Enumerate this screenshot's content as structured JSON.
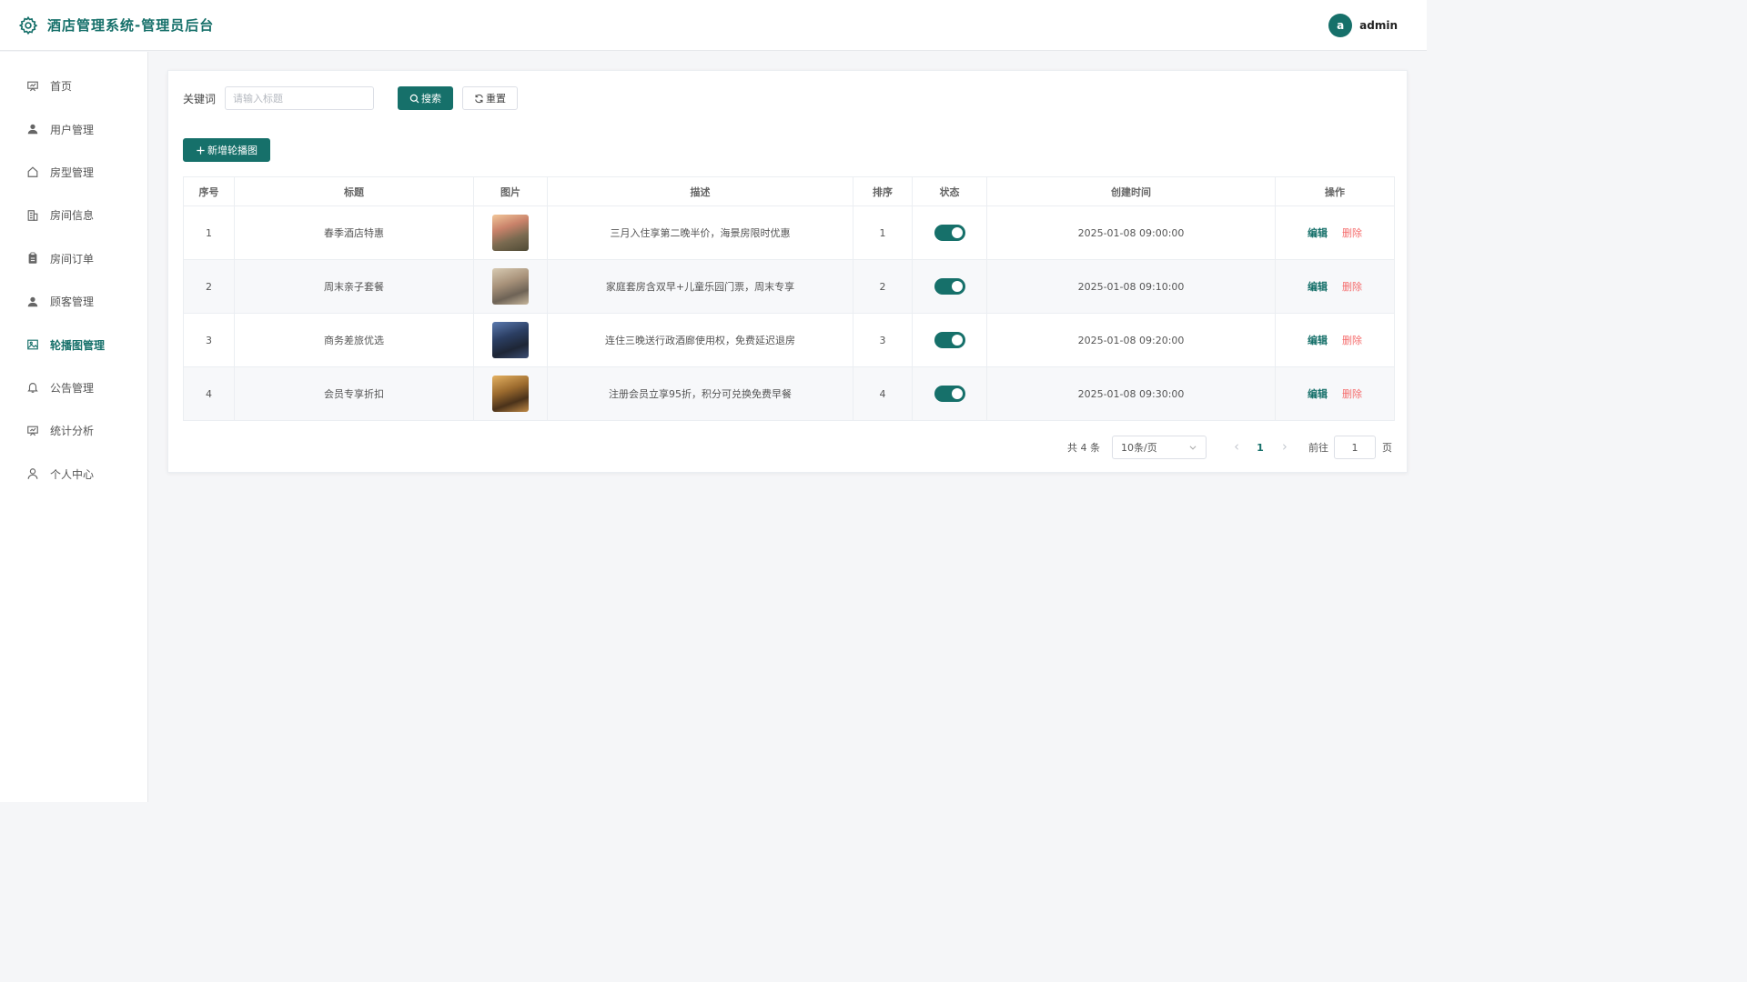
{
  "header": {
    "title": "酒店管理系统-管理员后台",
    "avatar_letter": "a",
    "username": "admin"
  },
  "sidebar": {
    "items": [
      {
        "label": "首页",
        "icon": "presentation-icon"
      },
      {
        "label": "用户管理",
        "icon": "user-icon"
      },
      {
        "label": "房型管理",
        "icon": "house-icon"
      },
      {
        "label": "房间信息",
        "icon": "building-icon"
      },
      {
        "label": "房间订单",
        "icon": "clipboard-icon"
      },
      {
        "label": "顾客管理",
        "icon": "user-icon"
      },
      {
        "label": "轮播图管理",
        "icon": "picture-icon",
        "active": true
      },
      {
        "label": "公告管理",
        "icon": "bell-icon"
      },
      {
        "label": "统计分析",
        "icon": "presentation-icon"
      },
      {
        "label": "个人中心",
        "icon": "user-outline-icon"
      }
    ]
  },
  "search": {
    "label": "关键词",
    "placeholder": "请输入标题",
    "search_label": "搜索",
    "reset_label": "重置"
  },
  "toolbar": {
    "add_label": "新增轮播图"
  },
  "table": {
    "headers": [
      "序号",
      "标题",
      "图片",
      "描述",
      "排序",
      "状态",
      "创建时间",
      "操作"
    ],
    "rows": [
      {
        "index": "1",
        "title": "春季酒店特惠",
        "desc": "三月入住享第二晚半价，海景房限时优惠",
        "sort": "1",
        "enabled": true,
        "created": "2025-01-08 09:00:00",
        "edit": "编辑",
        "delete": "删除"
      },
      {
        "index": "2",
        "title": "周末亲子套餐",
        "desc": "家庭套房含双早+儿童乐园门票，周末专享",
        "sort": "2",
        "enabled": true,
        "created": "2025-01-08 09:10:00",
        "edit": "编辑",
        "delete": "删除"
      },
      {
        "index": "3",
        "title": "商务差旅优选",
        "desc": "连住三晚送行政酒廊使用权，免费延迟退房",
        "sort": "3",
        "enabled": true,
        "created": "2025-01-08 09:20:00",
        "edit": "编辑",
        "delete": "删除"
      },
      {
        "index": "4",
        "title": "会员专享折扣",
        "desc": "注册会员立享95折，积分可兑换免费早餐",
        "sort": "4",
        "enabled": true,
        "created": "2025-01-08 09:30:00",
        "edit": "编辑",
        "delete": "删除"
      }
    ]
  },
  "pagination": {
    "total": "共 4 条",
    "page_size": "10条/页",
    "current_page": "1",
    "goto_label": "前往",
    "goto_value": "1",
    "page_unit": "页"
  },
  "colors": {
    "primary": "#16706a",
    "danger": "#f56c6c"
  }
}
